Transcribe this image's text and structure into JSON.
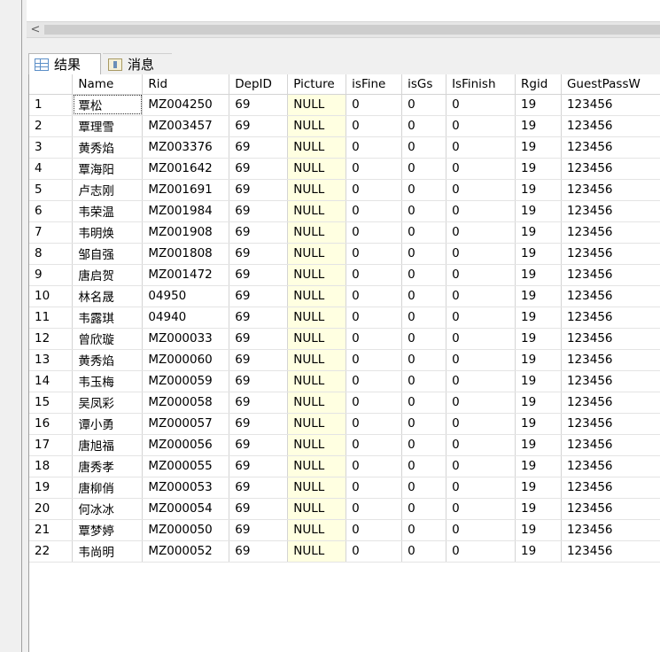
{
  "scrollbar": {
    "left_arrow": "<"
  },
  "tabs": [
    {
      "label": "结果",
      "icon": "results-grid-icon",
      "active": true
    },
    {
      "label": "消息",
      "icon": "messages-icon",
      "active": false
    }
  ],
  "columns": [
    "",
    "Name",
    "Rid",
    "DepID",
    "Picture",
    "isFine",
    "isGs",
    "IsFinish",
    "Rgid",
    "GuestPassW"
  ],
  "rows": [
    [
      "1",
      "覃松",
      "MZ004250",
      "69",
      "NULL",
      "0",
      "0",
      "0",
      "19",
      "123456"
    ],
    [
      "2",
      "覃理雪",
      "MZ003457",
      "69",
      "NULL",
      "0",
      "0",
      "0",
      "19",
      "123456"
    ],
    [
      "3",
      "黄秀焰",
      "MZ003376",
      "69",
      "NULL",
      "0",
      "0",
      "0",
      "19",
      "123456"
    ],
    [
      "4",
      "覃海阳",
      "MZ001642",
      "69",
      "NULL",
      "0",
      "0",
      "0",
      "19",
      "123456"
    ],
    [
      "5",
      "卢志刚",
      "MZ001691",
      "69",
      "NULL",
      "0",
      "0",
      "0",
      "19",
      "123456"
    ],
    [
      "6",
      "韦荣温",
      "MZ001984",
      "69",
      "NULL",
      "0",
      "0",
      "0",
      "19",
      "123456"
    ],
    [
      "7",
      "韦明焕",
      "MZ001908",
      "69",
      "NULL",
      "0",
      "0",
      "0",
      "19",
      "123456"
    ],
    [
      "8",
      "邹自强",
      "MZ001808",
      "69",
      "NULL",
      "0",
      "0",
      "0",
      "19",
      "123456"
    ],
    [
      "9",
      "唐启贺",
      "MZ001472",
      "69",
      "NULL",
      "0",
      "0",
      "0",
      "19",
      "123456"
    ],
    [
      "10",
      "林名晟",
      "04950",
      "69",
      "NULL",
      "0",
      "0",
      "0",
      "19",
      "123456"
    ],
    [
      "11",
      "韦露琪",
      "04940",
      "69",
      "NULL",
      "0",
      "0",
      "0",
      "19",
      "123456"
    ],
    [
      "12",
      "曾欣璇",
      "MZ000033",
      "69",
      "NULL",
      "0",
      "0",
      "0",
      "19",
      "123456"
    ],
    [
      "13",
      "黄秀焰",
      "MZ000060",
      "69",
      "NULL",
      "0",
      "0",
      "0",
      "19",
      "123456"
    ],
    [
      "14",
      "韦玉梅",
      "MZ000059",
      "69",
      "NULL",
      "0",
      "0",
      "0",
      "19",
      "123456"
    ],
    [
      "15",
      "吴凤彩",
      "MZ000058",
      "69",
      "NULL",
      "0",
      "0",
      "0",
      "19",
      "123456"
    ],
    [
      "16",
      "谭小勇",
      "MZ000057",
      "69",
      "NULL",
      "0",
      "0",
      "0",
      "19",
      "123456"
    ],
    [
      "17",
      "唐旭福",
      "MZ000056",
      "69",
      "NULL",
      "0",
      "0",
      "0",
      "19",
      "123456"
    ],
    [
      "18",
      "唐秀孝",
      "MZ000055",
      "69",
      "NULL",
      "0",
      "0",
      "0",
      "19",
      "123456"
    ],
    [
      "19",
      "唐柳俏",
      "MZ000053",
      "69",
      "NULL",
      "0",
      "0",
      "0",
      "19",
      "123456"
    ],
    [
      "20",
      "何冰冰",
      "MZ000054",
      "69",
      "NULL",
      "0",
      "0",
      "0",
      "19",
      "123456"
    ],
    [
      "21",
      "覃梦婷",
      "MZ000050",
      "69",
      "NULL",
      "0",
      "0",
      "0",
      "19",
      "123456"
    ],
    [
      "22",
      "韦尚明",
      "MZ000052",
      "69",
      "NULL",
      "0",
      "0",
      "0",
      "19",
      "123456"
    ]
  ]
}
